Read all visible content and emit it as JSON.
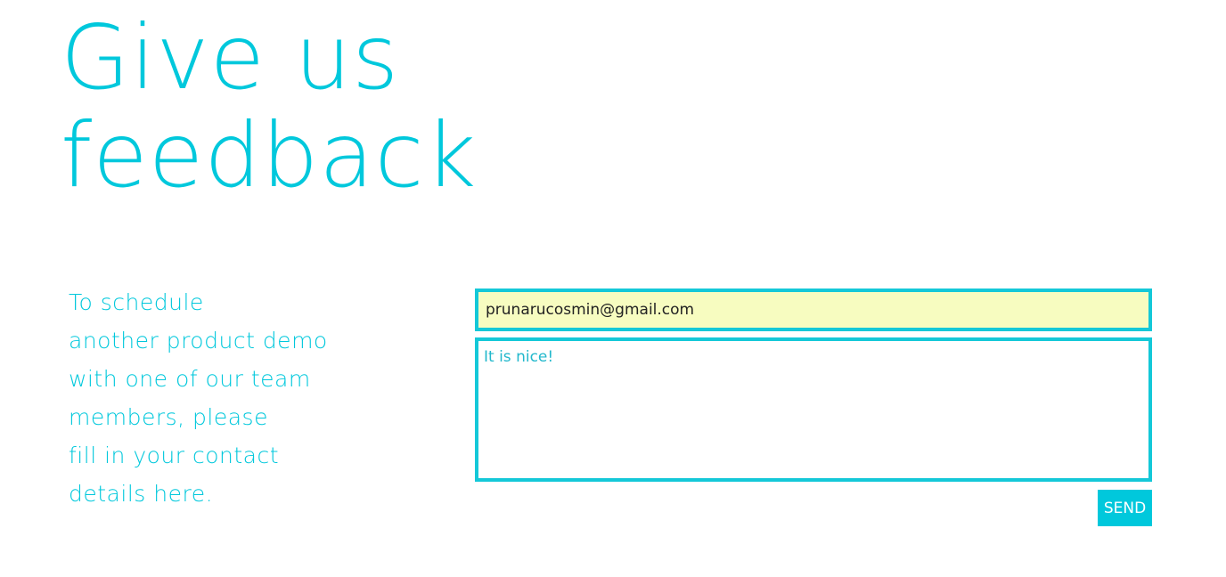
{
  "hero": {
    "title_line1": "Give us",
    "title_line2": "feedback"
  },
  "description": {
    "lines": [
      "To schedule",
      "another product demo",
      "with one of our team",
      "members, please",
      "fill in your contact",
      "details here."
    ]
  },
  "form": {
    "email_value": "prunarucosmin@gmail.com",
    "message_value": "It is nice!",
    "send_label": "SEND"
  },
  "colors": {
    "accent": "#00c8dc",
    "autofill_background": "#f7fcc0"
  }
}
